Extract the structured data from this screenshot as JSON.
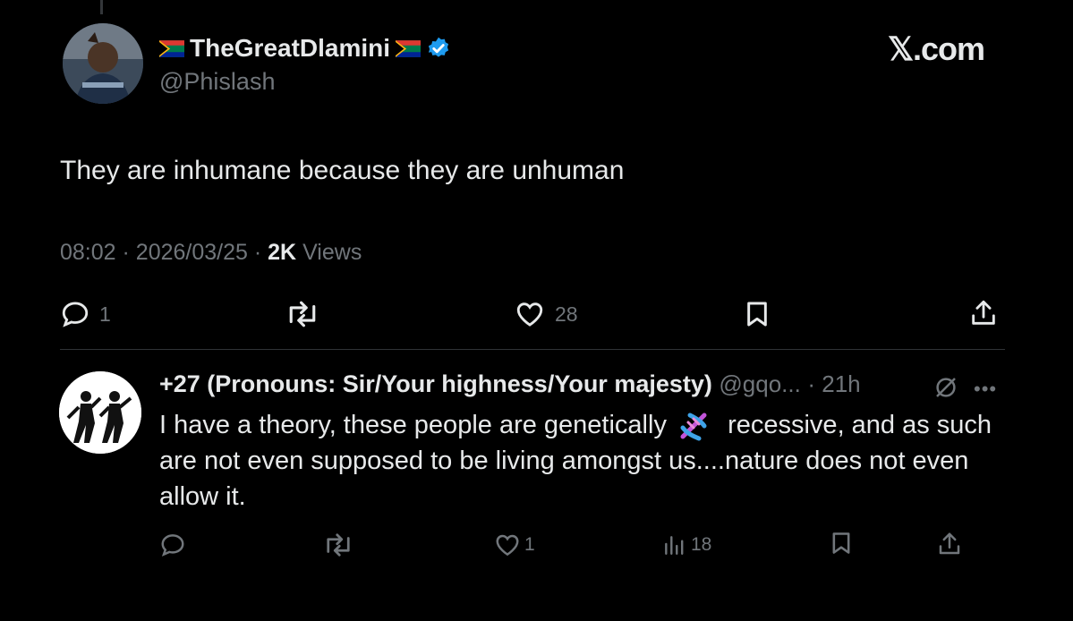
{
  "tweet": {
    "author": {
      "display_name": "TheGreatDlamini",
      "handle": "@Phislash",
      "verified": true,
      "avatar": "profile-photo"
    },
    "brand": "𝕏.com",
    "text": "They are inhumane because they are unhuman",
    "time": "08:02",
    "date": "2026/03/25",
    "views_count": "2K",
    "views_label": "Views",
    "actions": {
      "replies": "1",
      "reposts": "",
      "likes": "28"
    }
  },
  "reply": {
    "display_name": "+27 (Pronouns: Sir/Your highness/Your majesty)",
    "handle": "@gqo...",
    "time": "21h",
    "text_before_emoji": "I have a theory, these people are genetically",
    "emoji": "dna-emoji",
    "text_after_emoji": "recessive, and as such are not even supposed to be living amongst us....nature does not even allow it.",
    "actions": {
      "replies": "",
      "reposts": "",
      "likes": "1",
      "views": "18"
    }
  },
  "colors": {
    "background": "#000000",
    "primary_text": "#e7e9ea",
    "secondary_text": "#71767b",
    "verified_badge": "#1d9bf0"
  },
  "icons": [
    "reply-icon",
    "repost-icon",
    "like-icon",
    "bookmark-icon",
    "share-icon",
    "views-icon",
    "grok-icon",
    "more-icon",
    "verified-icon",
    "south-africa-flag-icon"
  ]
}
